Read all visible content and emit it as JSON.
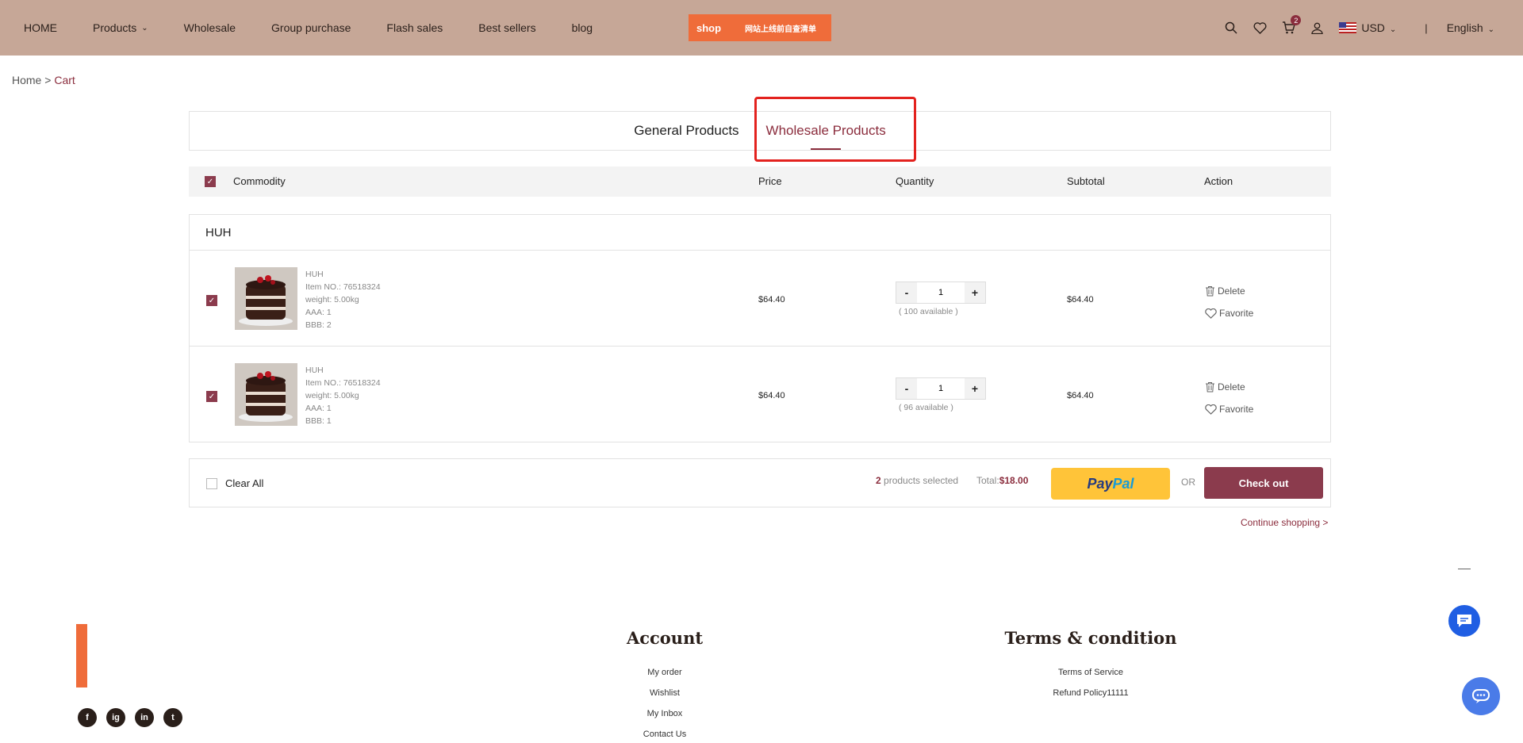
{
  "header": {
    "nav": [
      {
        "label": "HOME"
      },
      {
        "label": "Products",
        "has_dropdown": true
      },
      {
        "label": "Wholesale"
      },
      {
        "label": "Group purchase"
      },
      {
        "label": "Flash sales"
      },
      {
        "label": "Best sellers"
      },
      {
        "label": "blog"
      }
    ],
    "logo_brand": "shop",
    "logo_tagline": "网站上线前自查清单",
    "cart_count": "2",
    "currency": "USD",
    "separator": "|",
    "language": "English"
  },
  "breadcrumb": {
    "home": "Home",
    "sep": " > ",
    "current": "Cart"
  },
  "tabs": [
    {
      "label": "General Products",
      "active": false
    },
    {
      "label": "Wholesale Products",
      "active": true
    }
  ],
  "table_header": {
    "commodity": "Commodity",
    "price": "Price",
    "quantity": "Quantity",
    "subtotal": "Subtotal",
    "action": "Action"
  },
  "group": {
    "name": "HUH",
    "items": [
      {
        "name": "HUH",
        "item_no": "Item NO.: 76518324",
        "weight": "weight: 5.00kg",
        "attr1": "AAA: 1",
        "attr2": "BBB: 2",
        "price": "$64.40",
        "qty": "1",
        "available": "( 100 available )",
        "subtotal": "$64.40",
        "delete": "Delete",
        "favorite": "Favorite",
        "checked": true
      },
      {
        "name": "HUH",
        "item_no": "Item NO.: 76518324",
        "weight": "weight: 5.00kg",
        "attr1": "AAA: 1",
        "attr2": "BBB: 1",
        "price": "$64.40",
        "qty": "1",
        "available": "( 96 available )",
        "subtotal": "$64.40",
        "delete": "Delete",
        "favorite": "Favorite",
        "checked": true
      }
    ]
  },
  "cartbar": {
    "clear_all": "Clear All",
    "selected_count": "2",
    "selected_text": " products selected",
    "total_label": "Total:",
    "total_amount": "$18.00",
    "paypal_1": "Pay",
    "paypal_2": "Pal",
    "or": "OR",
    "checkout": "Check out"
  },
  "continue_shopping": "Continue shopping >",
  "footer": {
    "account_title": "Account",
    "account_links": [
      "My order",
      "Wishlist",
      "My Inbox",
      "Contact Us"
    ],
    "terms_title": "Terms & condition",
    "terms_links": [
      "Terms of Service",
      "Refund Policy11111"
    ],
    "social": [
      "f",
      "ig",
      "in",
      "t"
    ]
  },
  "colors": {
    "header_bg": "#c6a797",
    "accent": "#8b2d3d",
    "highlight": "#e3221e",
    "paypal": "#ffc439"
  }
}
